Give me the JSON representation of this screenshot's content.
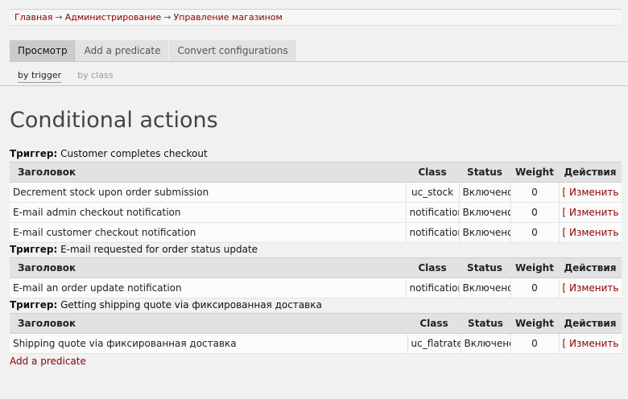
{
  "breadcrumb": {
    "items": [
      "Главная",
      "Администрирование",
      "Управление магазином"
    ],
    "separator": "→"
  },
  "tabs": [
    "Просмотр",
    "Add a predicate",
    "Convert configurations"
  ],
  "subtabs": [
    "by trigger",
    "by class"
  ],
  "page_title": "Conditional actions",
  "trigger_label": "Триггер:",
  "columns": {
    "title": "Заголовок",
    "class": "Class",
    "status": "Status",
    "weight": "Weight",
    "actions": "Действия"
  },
  "groups": [
    {
      "trigger": "Customer completes checkout",
      "rows": [
        {
          "title": "Decrement stock upon order submission",
          "class": "uc_stock",
          "status": "Включено",
          "weight": "0",
          "action": "[ Изменить ]"
        },
        {
          "title": "E-mail admin checkout notification",
          "class": "notification",
          "status": "Включено",
          "weight": "0",
          "action": "[ Изменить ]"
        },
        {
          "title": "E-mail customer checkout notification",
          "class": "notification",
          "status": "Включено",
          "weight": "0",
          "action": "[ Изменить ]"
        }
      ]
    },
    {
      "trigger": "E-mail requested for order status update",
      "rows": [
        {
          "title": "E-mail an order update notification",
          "class": "notification",
          "status": "Включено",
          "weight": "0",
          "action": "[ Изменить ]"
        }
      ]
    },
    {
      "trigger": "Getting shipping quote via фиксированная доставка",
      "rows": [
        {
          "title": "Shipping quote via фиксированная доставка",
          "class": "uc_flatrate",
          "status": "Включено",
          "weight": "0",
          "action": "[ Изменить ]"
        }
      ]
    }
  ],
  "add_link": "Add a predicate"
}
